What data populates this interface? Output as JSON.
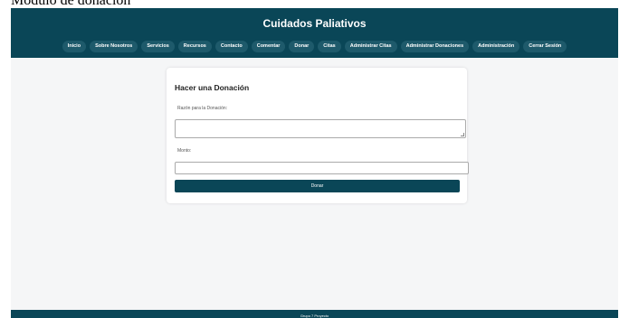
{
  "caption": "Modulo de donación",
  "header": {
    "title": "Cuidados Paliativos",
    "nav": [
      {
        "label": "Inicio"
      },
      {
        "label": "Sobre Nosotros"
      },
      {
        "label": "Servicios"
      },
      {
        "label": "Recursos"
      },
      {
        "label": "Contacto"
      },
      {
        "label": "Comentar"
      },
      {
        "label": "Donar"
      },
      {
        "label": "Citas"
      },
      {
        "label": "Administrar Citas"
      },
      {
        "label": "Administrar Donaciones"
      },
      {
        "label": "Administración"
      },
      {
        "label": "Cerrar Sesión"
      }
    ]
  },
  "form": {
    "title": "Hacer una Donación",
    "reason_label": "Razón para la Donación:",
    "reason_value": "",
    "amount_label": "Monto:",
    "amount_value": "",
    "submit_label": "Donar"
  },
  "footer": {
    "text": "Grupo 7 Proyecto"
  },
  "colors": {
    "primary": "#0a4657",
    "background": "#f5f6f7",
    "nav_pill": "#1e5a6b"
  }
}
